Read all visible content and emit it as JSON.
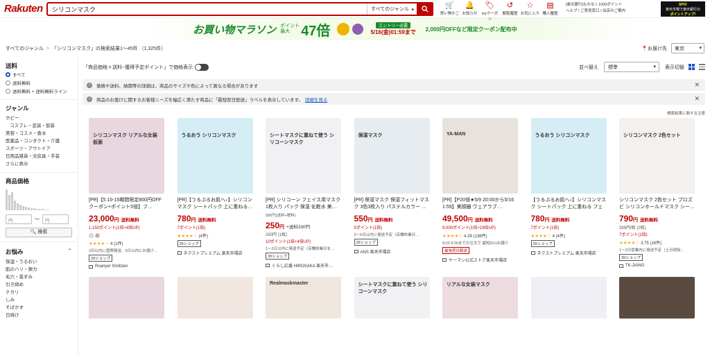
{
  "header": {
    "logo": "Rakuten",
    "search_value": "シリコンマスク",
    "genre": "すべてのジャンル",
    "icons": [
      {
        "label": "買い物かご",
        "icon": "cart-icon"
      },
      {
        "label": "お知らせ",
        "icon": "bell-icon"
      },
      {
        "label": "myクーポン",
        "icon": "coupon-icon"
      },
      {
        "label": "閲覧履歴",
        "icon": "history-icon"
      },
      {
        "label": "お気に入り",
        "icon": "star-icon"
      },
      {
        "label": "購入履歴",
        "icon": "receipt-icon"
      }
    ],
    "bank_text": "[楽天銀行]もれなく1000ポイント",
    "help_text": "ヘルプ / ご意見窓口 / 出店のご案内",
    "banner_line1": "SPU!",
    "banner_line2": "楽天市場で楽天銀行の",
    "banner_line3": "ポイントアップ!"
  },
  "promo": {
    "title": "お買い物マラソン",
    "points_label_1": "ポイント",
    "points_label_2": "最大",
    "points_value": "47倍",
    "entry": "エントリー必要",
    "deadline": "5/16(金)01:59まで",
    "coupon": "2,000円OFFなど限定クーポン配布中"
  },
  "breadcrumb": {
    "root": "すべてのジャンル",
    "result": "「シリコンマスク」の検索結果1〜45件 （1,325件）",
    "deliver_label": "お届け先",
    "deliver_value": "東京"
  },
  "sidebar": {
    "shipping_title": "送料",
    "shipping_options": [
      "すべて",
      "送料無料",
      "送料無料 + 送料無料ライン"
    ],
    "genre_title": "ジャンル",
    "genres": [
      "ホビー",
      "コスプレ・変装・仮装",
      "美容・コスメ・香水",
      "医薬品・コンタクト・介護",
      "スポーツ・アウトドア",
      "日用品雑貨・文房具・手芸",
      "さらに表示"
    ],
    "price_title": "商品価格",
    "price_min": "円",
    "price_max": "円",
    "price_sep": "〜",
    "search_button": "検索",
    "nayami_title": "お悩み",
    "nayami": [
      "保湿・うるおい",
      "肌のハリ・弾力",
      "毛穴・黒ずみ",
      "引き締め",
      "テカリ",
      "しみ",
      "そばかす",
      "日焼け"
    ]
  },
  "toolbar": {
    "price_display": "「商品価格＋送料−獲得予定ポイント」で価格表示",
    "sort_label": "並べ替え",
    "sort_value": "標準",
    "view_label": "表示切替"
  },
  "notices": [
    {
      "text": "価格や送料、納期等の詳細は、商品のサイズや色によって異なる場合があります",
      "link": ""
    },
    {
      "text": "商品のお届けに関するお客様ニーズを幅広く満たす商品に「最短翌日配送」ラベルを表示しています。",
      "link": "詳細を見る"
    }
  ],
  "related_note": "検索結果に関する注意",
  "products": [
    {
      "img_text": "シリコンマスク リアルな女装仮面",
      "img_bg": "#e9d7df",
      "title": "[PR]【5.10-15期間限定800円OFFクーポン+ポイント5倍】フ…",
      "price": "23,000",
      "unit": "円",
      "ship": "送料無料",
      "points": "1,150ポイント(1倍+4倍UP)",
      "stars": "★★★★☆",
      "reviews": "4 (1件)",
      "ship_note": "3日以内に国際発送、5日以内にお届け…",
      "badge": "39ショップ",
      "shop": "Roanyer Smitizen"
    },
    {
      "img_text": "うるおう シリコンマスク",
      "img_bg": "#d5edf5",
      "title": "[PR]【うるぷるお肌へ♪】シリコンマスク シートパック 上に重ねる…",
      "price": "780",
      "unit": "円",
      "ship": "送料無料",
      "points": "7ポイント(1倍)",
      "stars": "★★★★☆",
      "reviews": "(4件)",
      "ship_note": "",
      "badge": "39ショップ",
      "shop": "ネクストプレミアム 楽天市場店"
    },
    {
      "img_text": "シートマスクに重ねて使う シリコーンマスク",
      "img_bg": "#f1f1f4",
      "title": "[PR] シリコーン フェイス用マスク 1枚入り パック 保湿 化粧水 美…",
      "price_pre": "580円(送料+税料)",
      "price": "250",
      "unit": "円",
      "ship": "+送料330円",
      "points_pre": "250円 (1枚)",
      "points": "10ポイント(1倍+4倍UP)",
      "stars": "",
      "reviews": "",
      "ship_note": "1〜2日以内に発送予定（店舗休業日を…",
      "badge": "39ショップ",
      "shop": "くらし応援 HIROSAKA 楽天市…"
    },
    {
      "img_text": "保湿マスク",
      "img_bg": "#e6ecef",
      "title": "[PR] 保湿マスク 保湿フィットマスク 3色3枚入り パステルカラー …",
      "price": "550",
      "unit": "円",
      "ship": "送料無料",
      "points": "5ポイント(1倍)",
      "stars": "",
      "reviews": "",
      "ship_note": "2〜5日以内に発送予定（店舗休業日…",
      "badge": "39ショップ",
      "shop": "ANS 楽天市場店"
    },
    {
      "img_text": "YA-MAN",
      "img_bg": "#e8e2dc",
      "title": "[PR]【P20倍★5/9 20:00から5/16 1:59】美顔器 ウェアラブ…",
      "price": "49,500",
      "unit": "円",
      "ship": "送料無料",
      "points": "9,000ポイント(1倍+19倍UP)",
      "stars": "★★★★☆",
      "reviews": "4.39 (136件)",
      "ship_note": "5/10 9:00までの注文で 最短5/11お届け",
      "badge": "最強翌日配送",
      "shop": "ヤーマン公式ストア楽天市場店"
    },
    {
      "img_text": "うるおう シリコンマスク",
      "img_bg": "#d5edf5",
      "title": "【うるぷるお肌へ♪】シリコンマスク シートパック 上に重ねる フェイ…",
      "price": "780",
      "unit": "円",
      "ship": "送料無料",
      "points": "7ポイント(1倍)",
      "stars": "★★★★☆",
      "reviews": "4 (4件)",
      "ship_note": "",
      "badge": "39ショップ",
      "shop": "ネクストプレミアム 楽天市場店"
    },
    {
      "img_text": "シリコンマスク 2色セット",
      "img_bg": "#f3f0ee",
      "title": "シリコンマスク 2色セット プロズビ シリコンホールドマスク シー…",
      "price": "790",
      "unit": "円",
      "ship": "送料無料",
      "points_pre": "395円/枚 (2枚)",
      "points": "7ポイント(1倍)",
      "stars": "★★★★☆",
      "reviews": "3.75 (16件)",
      "ship_note": "1〜2日営業内に発送予定（土日祝除…",
      "badge": "39ショップ",
      "shop": "TK-JIANG"
    }
  ],
  "products_row2": [
    {
      "img_text": "",
      "img_bg": "#e9d7df"
    },
    {
      "img_text": "",
      "img_bg": "#f2e6e0"
    },
    {
      "img_text": "Realmaskmaster",
      "img_bg": "#efe7dd"
    },
    {
      "img_text": "シートマスクに重ねて使う シリコーンマスク",
      "img_bg": "#f1f1f4"
    },
    {
      "img_text": "リアルな女装マスク",
      "img_bg": "#ecdcdf"
    },
    {
      "img_text": "",
      "img_bg": "#f0eff5"
    },
    {
      "img_text": "",
      "img_bg": "#5a4a40"
    }
  ],
  "colors": {
    "accent": "#bf0000",
    "promo_green": "#1a8a2a",
    "link": "#1a55c5"
  }
}
